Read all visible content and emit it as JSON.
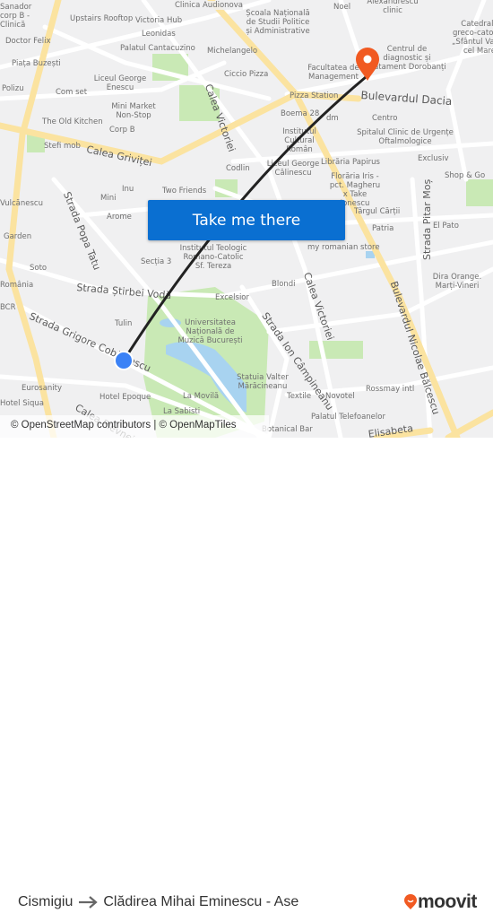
{
  "colors": {
    "route_line": "#222222",
    "origin_dot": "#3b82f6",
    "destination_pin": "#f15a22",
    "cta": "#0a6fd1",
    "major_road": "#fbe3a0",
    "park": "#c9e9b5",
    "water": "#a8d3f0",
    "brand": "#f15a22"
  },
  "map": {
    "streets": [
      "Calea Victoriei",
      "Calea Griviței",
      "Bulevardul Dacia",
      "Strada Popa Tatu",
      "Strada Știrbei Vodă",
      "Strada Grigore Cobălcescu",
      "Calea Victoriei",
      "Strada Ion Câmpineanu",
      "Bulevardul Nicolae Bălcescu",
      "Strada Pitar Moș",
      "Calea Plevnei",
      "Elisabeta"
    ],
    "labels": [
      "Upstairs Rooftop",
      "Victoria Hub",
      "Leonidas",
      "Palatul Cantacuzino",
      "Michelangelo",
      "Ciccio Pizza",
      "Doctor Felix",
      "Piața Buzești",
      "Polizu",
      "Com set",
      "Liceul George Enescu",
      "Mini Market Non-Stop",
      "The Old Kitchen",
      "Corp B",
      "Stefi mob",
      "Inu",
      "Two Friends",
      "Mini",
      "Vulcănescu",
      "Arome",
      "Garden",
      "Soto",
      "România",
      "BCR",
      "Secția 3",
      "Institutul Teologic Romano-Catolic Sf. Tereza",
      "Excelsior",
      "Tulin",
      "Universitatea Națională de Muzică București",
      "Eurosanity",
      "Hotel Epoque",
      "La Movilă",
      "La Sabisti",
      "Hotel Siqua",
      "Școala Națională de Studii Politice și Administrative",
      "Noel",
      "Alexandrescu clinic",
      "Catedrala greco-catolică „Sfântul Vasile cel Mare",
      "Centrul de diagnostic și tratament Dorobanți",
      "Facultatea de Management",
      "Pizza Station",
      "Boema 28",
      "dm",
      "Centro",
      "Institutul Cultural Român",
      "Spitalul Clinic de Urgențe Oftalmologice",
      "Liceul George Călinescu",
      "Librăria Papirus",
      "Exclusiv",
      "Florăria Iris - pct. Magheru x Take Ionescu",
      "Shop & Go",
      "Codlin",
      "Târgul Cărții",
      "Patria",
      "El Pato",
      "my romanian store",
      "Blondi",
      "Dira Orange. Marți-Vineri",
      "Statuia Valter Mărăcineanu",
      "Textile",
      "Novotel",
      "Rossmay intl",
      "Palatul Telefoanelor",
      "Botanical Bar",
      "Clinica Audionova",
      "Sanador corp B - Clinică"
    ]
  },
  "cta": {
    "label": "Take me there"
  },
  "attribution": "© OpenStreetMap contributors | © OpenMapTiles",
  "footer": {
    "origin": "Cismigiu",
    "destination": "Clădirea Mihai Eminescu - Ase",
    "brand": "moovit"
  },
  "icons": {
    "arrow": "arrow-right-icon",
    "pin": "map-pin-icon",
    "origin": "origin-dot-icon",
    "logo": "moovit-logo-icon"
  }
}
